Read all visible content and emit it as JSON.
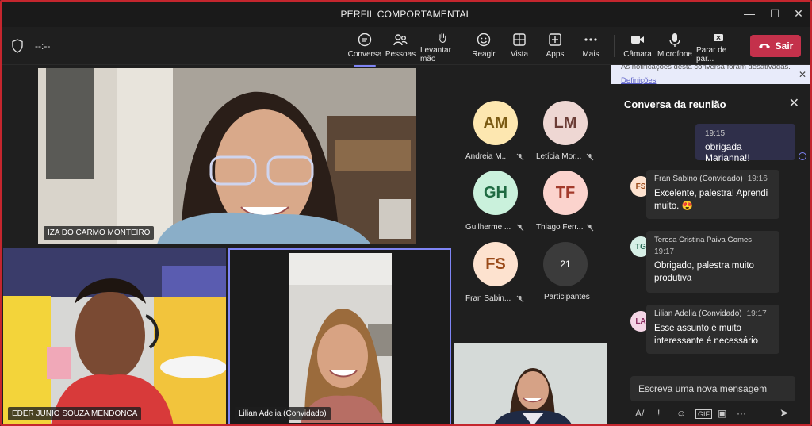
{
  "window": {
    "title": "PERFIL COMPORTAMENTAL",
    "minimize": "—",
    "maximize": "☐",
    "close": "✕"
  },
  "toolbar": {
    "timer": "--:--",
    "buttons": [
      {
        "id": "conversa",
        "label": "Conversa",
        "icon": "chat-icon"
      },
      {
        "id": "pessoas",
        "label": "Pessoas",
        "icon": "people-icon"
      },
      {
        "id": "levantar",
        "label": "Levantar mão",
        "icon": "raise-hand-icon"
      },
      {
        "id": "reagir",
        "label": "Reagir",
        "icon": "smile-icon"
      },
      {
        "id": "vista",
        "label": "Vista",
        "icon": "grid-icon"
      },
      {
        "id": "apps",
        "label": "Apps",
        "icon": "plus-icon"
      },
      {
        "id": "mais",
        "label": "Mais",
        "icon": "more-icon"
      },
      {
        "id": "camara",
        "label": "Câmara",
        "icon": "camera-icon"
      },
      {
        "id": "microfone",
        "label": "Microfone",
        "icon": "mic-icon"
      },
      {
        "id": "parar",
        "label": "Parar de par...",
        "icon": "stop-share-icon"
      }
    ],
    "leave_label": "Sair"
  },
  "videos": {
    "iza": "IZA DO CARMO MONTEIRO",
    "eder": "EDER JUNIO SOUZA MENDONCA",
    "lilian": "Lilian Adelia (Convidado)"
  },
  "roster": [
    {
      "initials": "AM",
      "name": "Andreia M...",
      "color": "#fde7b0",
      "text": "#7a5a12"
    },
    {
      "initials": "LM",
      "name": "Letícia Mor...",
      "color": "#eed7d3",
      "text": "#6b3d36"
    },
    {
      "initials": "GH",
      "name": "Guilherme ...",
      "color": "#caf1dc",
      "text": "#1f6b42"
    },
    {
      "initials": "TF",
      "name": "Thiago Ferr...",
      "color": "#fbd3cd",
      "text": "#a33a2b"
    },
    {
      "initials": "FS",
      "name": "Fran Sabin...",
      "color": "#fde2cf",
      "text": "#9a4a19"
    }
  ],
  "participants": {
    "count": "21",
    "label": "Participantes"
  },
  "chat": {
    "notice_line1": "As notificações desta conversa foram desativadas.",
    "notice_link": "Definições",
    "title": "Conversa da reunião",
    "own": {
      "time": "19:15",
      "text": "obrigada Marianna!!"
    },
    "messages": [
      {
        "initials": "FS",
        "author": "Fran Sabino (Convidado)",
        "time": "19:16",
        "text": "Excelente, palestra! Aprendi muito. 😍",
        "color": "#fde2cf",
        "tcolor": "#9a4a19"
      },
      {
        "initials": "TG",
        "author": "Teresa Cristina Paiva Gomes",
        "time": "19:17",
        "text": "Obrigado, palestra muito produtiva",
        "color": "#d6efe6",
        "tcolor": "#2a6b55"
      },
      {
        "initials": "LA",
        "author": "Lilian Adelia (Convidado)",
        "time": "19:17",
        "text": "Esse assunto é muito interessante é necessário",
        "color": "#f4d6e6",
        "tcolor": "#8a2d60"
      }
    ],
    "compose_placeholder": "Escreva uma nova mensagem"
  }
}
